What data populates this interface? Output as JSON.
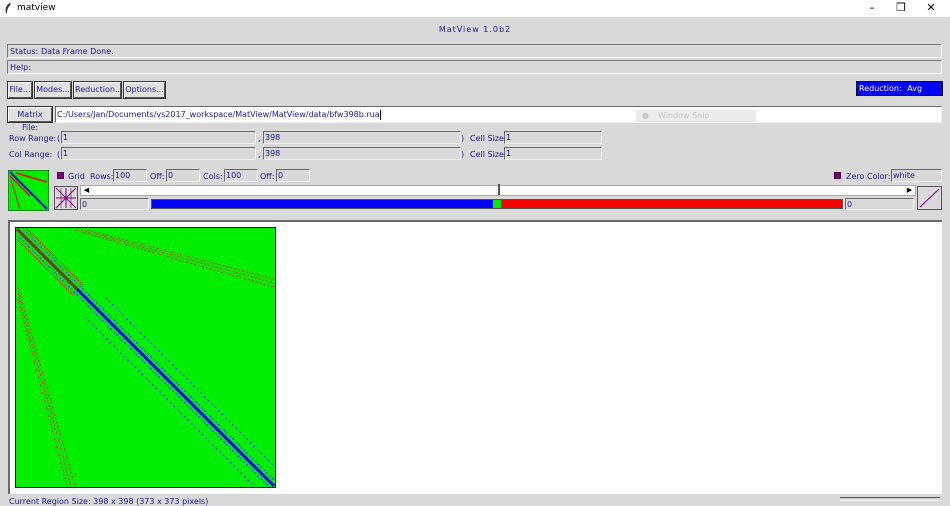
{
  "window": {
    "title": "matview"
  },
  "app": {
    "title": "MatView  1.0b2"
  },
  "status": {
    "label": "Status:",
    "text": "Data Frame Done."
  },
  "help": {
    "label": "Help:",
    "text": ""
  },
  "menu": {
    "file": "File...",
    "modes": "Modes...",
    "reduction": "Reduction...",
    "options": "Options..."
  },
  "reduction_badge": {
    "label": "Reduction:",
    "value": "Avg"
  },
  "matrix_file": {
    "label": "Matrix File:",
    "path": "C:/Users/Jan/Documents/vs2017_workspace/MatView/MatView/data/bfw398b.rua"
  },
  "window_snip": "Window Snip",
  "row_range": {
    "label": "Row Range:",
    "open": "(",
    "start": "1",
    "sep": ",",
    "end": "398",
    "close": ")",
    "cell_label": "Cell Size:",
    "cell_size": "1"
  },
  "col_range": {
    "label": "Col Range:",
    "open": "(",
    "start": "1",
    "sep": ",",
    "end": "398",
    "close": ")",
    "cell_label": "Cell Size:",
    "cell_size": "1"
  },
  "grid": {
    "label": "Grid",
    "rows_label": "Rows:",
    "rows": "100",
    "off_label": "Off:",
    "row_off": "0",
    "cols_label": "Cols:",
    "cols": "100",
    "col_off": "0"
  },
  "zero_color": {
    "label": "Zero Color:",
    "value": "white"
  },
  "colorbar": {
    "min": "0",
    "max": "0",
    "slider_position": 0.5
  },
  "footer": {
    "region": "Current Region Size:  398 x 398  (373 x 373 pixels)"
  },
  "colors": {
    "accent": "#0000ff",
    "text": "#1a1a9c",
    "matrix_bg": "#00ee00",
    "neg": "#0000ff",
    "pos": "#ff0000"
  }
}
